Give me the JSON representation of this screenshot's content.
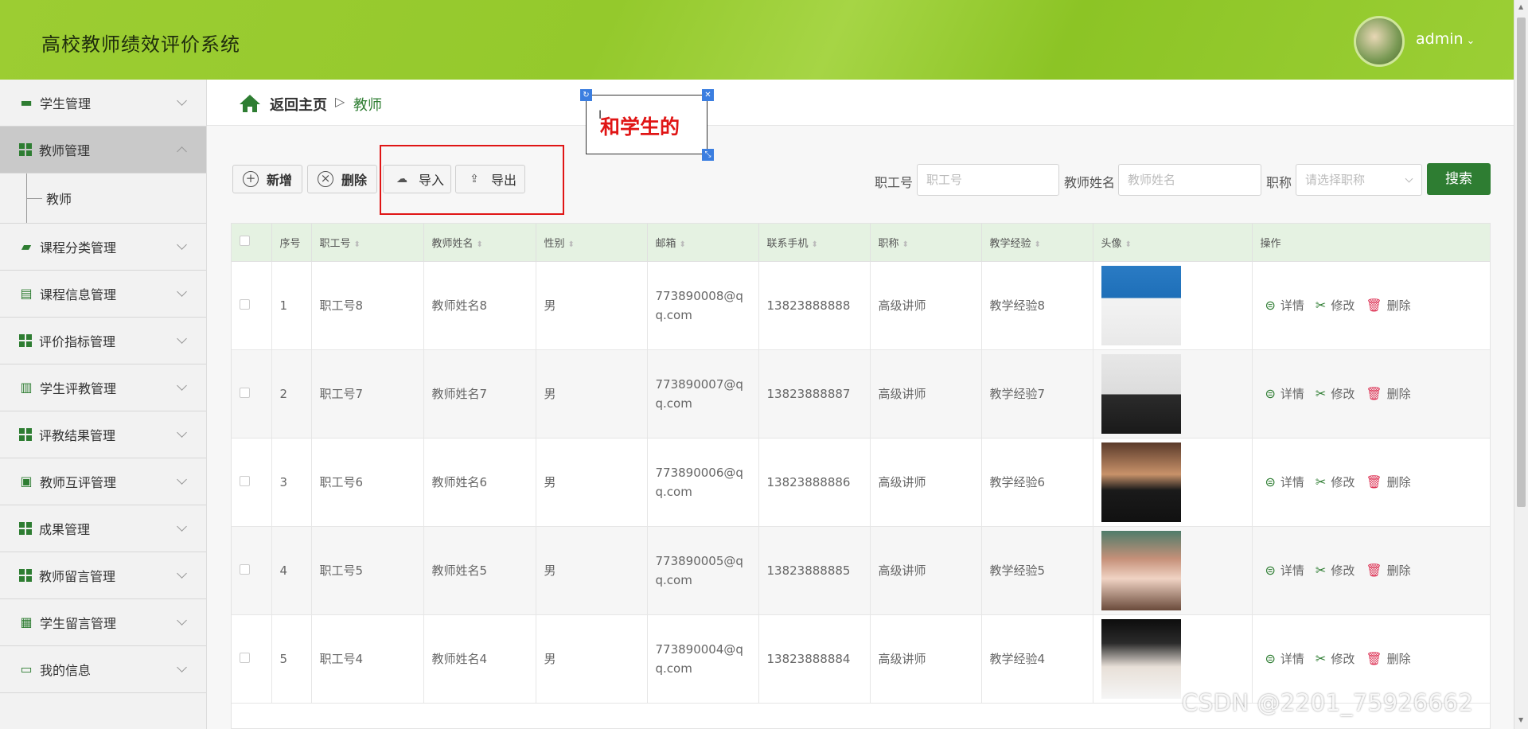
{
  "header": {
    "title": "高校教师绩效评价系统",
    "user": "admin"
  },
  "sidebar": {
    "items": [
      {
        "label": "学生管理",
        "icon": "monitor-icon"
      },
      {
        "label": "教师管理",
        "icon": "grid-icon",
        "active": true,
        "children": [
          {
            "label": "教师"
          }
        ]
      },
      {
        "label": "课程分类管理",
        "icon": "ticket-icon"
      },
      {
        "label": "课程信息管理",
        "icon": "wallet-icon"
      },
      {
        "label": "评价指标管理",
        "icon": "grid-icon"
      },
      {
        "label": "学生评教管理",
        "icon": "clipboard-icon"
      },
      {
        "label": "评教结果管理",
        "icon": "grid-icon"
      },
      {
        "label": "教师互评管理",
        "icon": "chat-icon"
      },
      {
        "label": "成果管理",
        "icon": "grid-icon"
      },
      {
        "label": "教师留言管理",
        "icon": "grid-icon"
      },
      {
        "label": "学生留言管理",
        "icon": "briefcase-icon"
      },
      {
        "label": "我的信息",
        "icon": "id-card-icon"
      }
    ]
  },
  "breadcrumb": {
    "home": "返回主页",
    "separator": "▷",
    "current": "教师"
  },
  "annotation": {
    "text": "和学生的"
  },
  "toolbar": {
    "add": "新增",
    "delete": "删除",
    "import": "导入",
    "export": "导出"
  },
  "filters": {
    "emp_no_label": "职工号",
    "emp_no_placeholder": "职工号",
    "name_label": "教师姓名",
    "name_placeholder": "教师姓名",
    "title_label": "职称",
    "title_placeholder": "请选择职称",
    "search": "搜索"
  },
  "table": {
    "headers": [
      "序号",
      "职工号",
      "教师姓名",
      "性别",
      "邮箱",
      "联系手机",
      "职称",
      "教学经验",
      "头像",
      "操作"
    ],
    "actions": {
      "detail": "详情",
      "edit": "修改",
      "delete": "删除"
    },
    "rows": [
      {
        "no": "1",
        "emp": "职工号8",
        "name": "教师姓名8",
        "gender": "男",
        "email": "773890008@qq.com",
        "phone": "13823888888",
        "title": "高级讲师",
        "exp": "教学经验8"
      },
      {
        "no": "2",
        "emp": "职工号7",
        "name": "教师姓名7",
        "gender": "男",
        "email": "773890007@qq.com",
        "phone": "13823888887",
        "title": "高级讲师",
        "exp": "教学经验7"
      },
      {
        "no": "3",
        "emp": "职工号6",
        "name": "教师姓名6",
        "gender": "男",
        "email": "773890006@qq.com",
        "phone": "13823888886",
        "title": "高级讲师",
        "exp": "教学经验6"
      },
      {
        "no": "4",
        "emp": "职工号5",
        "name": "教师姓名5",
        "gender": "男",
        "email": "773890005@qq.com",
        "phone": "13823888885",
        "title": "高级讲师",
        "exp": "教学经验5"
      },
      {
        "no": "5",
        "emp": "职工号4",
        "name": "教师姓名4",
        "gender": "男",
        "email": "773890004@qq.com",
        "phone": "13823888884",
        "title": "高级讲师",
        "exp": "教学经验4"
      }
    ]
  },
  "watermark": "CSDN @2201_75926662",
  "colors": {
    "brand_green": "#2e7d32",
    "header_green": "#9ccd32",
    "annotation_red": "#e01515"
  }
}
